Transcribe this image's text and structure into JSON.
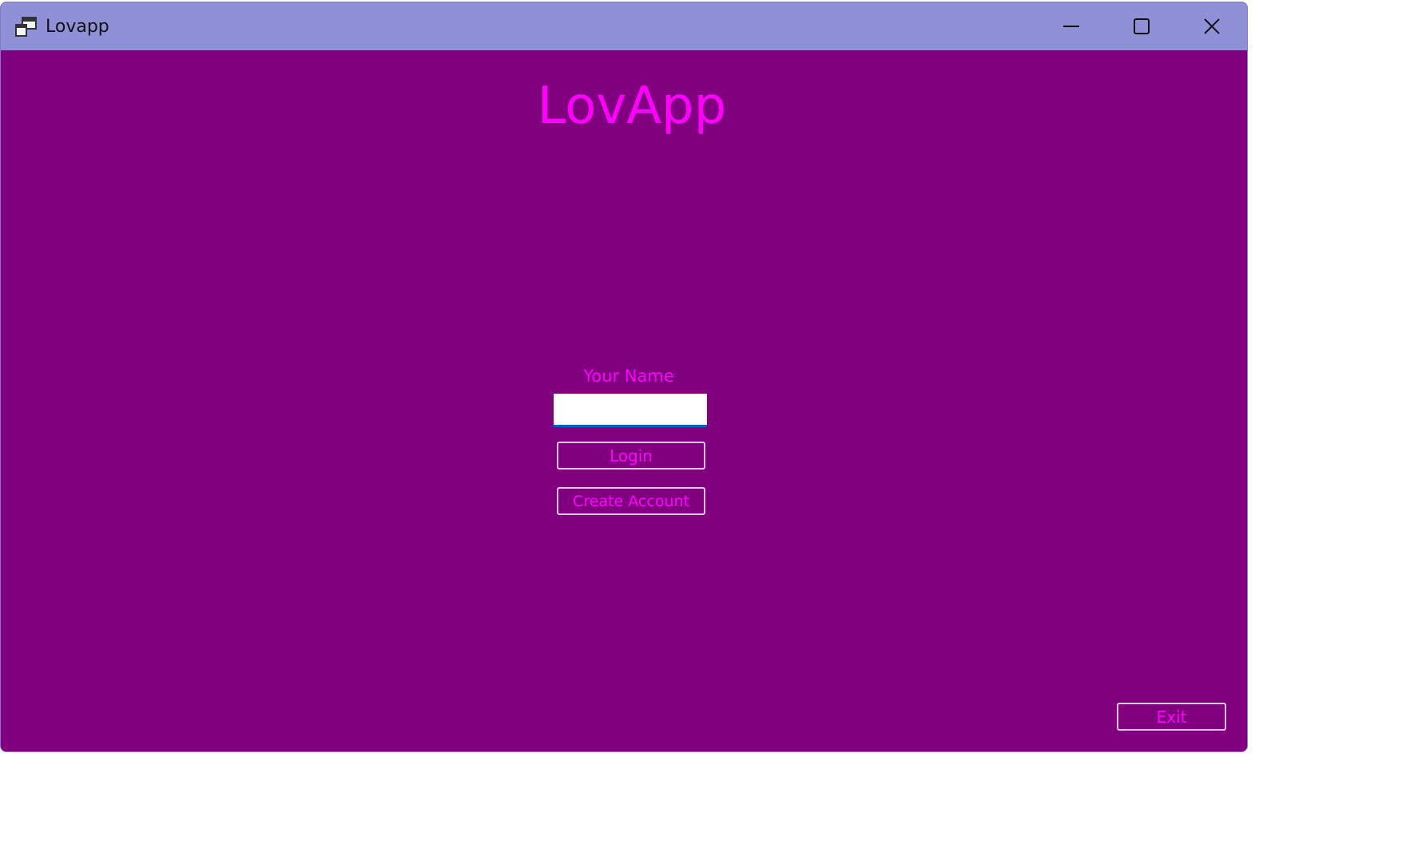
{
  "window": {
    "title": "Lovapp",
    "icon": "app-window-icon",
    "controls": {
      "minimize_icon": "minimize-icon",
      "maximize_icon": "maximize-icon",
      "close_icon": "close-icon"
    }
  },
  "main": {
    "heading": "LovApp",
    "name_label": "Your Name",
    "name_value": "",
    "login_label": "Login",
    "create_account_label": "Create Account",
    "exit_label": "Exit"
  },
  "colors": {
    "background": "#800080",
    "titlebar": "#9090d8",
    "accent_text": "#ff00ff",
    "input_underline": "#0060c0",
    "button_border": "#e6c8e6"
  }
}
